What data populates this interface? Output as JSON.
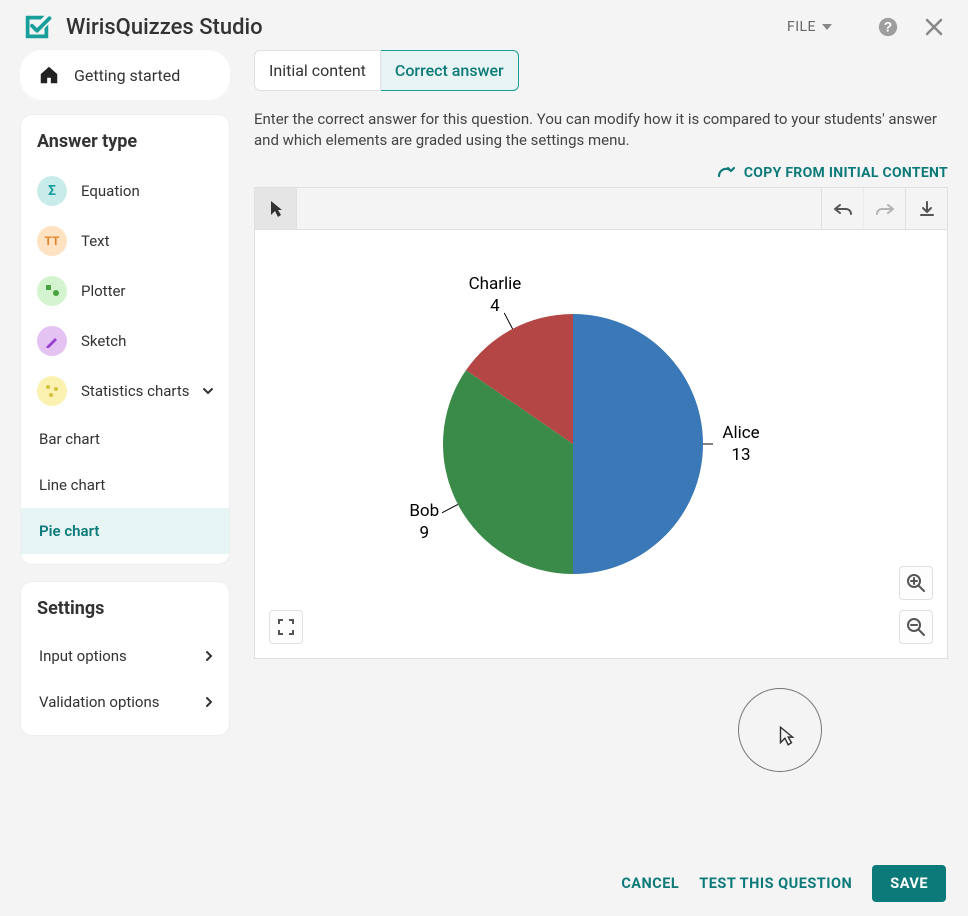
{
  "header": {
    "title": "WirisQuizzes Studio",
    "file_menu": "FILE"
  },
  "sidebar": {
    "getting_started": "Getting started",
    "answer_type_heading": "Answer type",
    "types": {
      "equation": "Equation",
      "text": "Text",
      "plotter": "Plotter",
      "sketch": "Sketch",
      "statistics": "Statistics charts"
    },
    "sub": {
      "bar": "Bar chart",
      "line": "Line chart",
      "pie": "Pie chart"
    },
    "settings_heading": "Settings",
    "settings": {
      "input": "Input options",
      "validation": "Validation options"
    }
  },
  "main": {
    "tabs": {
      "initial": "Initial content",
      "correct": "Correct answer"
    },
    "instructions": "Enter the correct answer for this question. You can modify how it is compared to your students' answer and which elements are graded using the settings menu.",
    "copy_link": "COPY FROM INITIAL CONTENT"
  },
  "footer": {
    "cancel": "CANCEL",
    "test": "TEST THIS QUESTION",
    "save": "SAVE"
  },
  "chart_data": {
    "type": "pie",
    "series": [
      {
        "name": "Alice",
        "value": 13,
        "color": "#3a78b8"
      },
      {
        "name": "Bob",
        "value": 9,
        "color": "#3a8b49"
      },
      {
        "name": "Charlie",
        "value": 4,
        "color": "#b44646"
      }
    ]
  }
}
